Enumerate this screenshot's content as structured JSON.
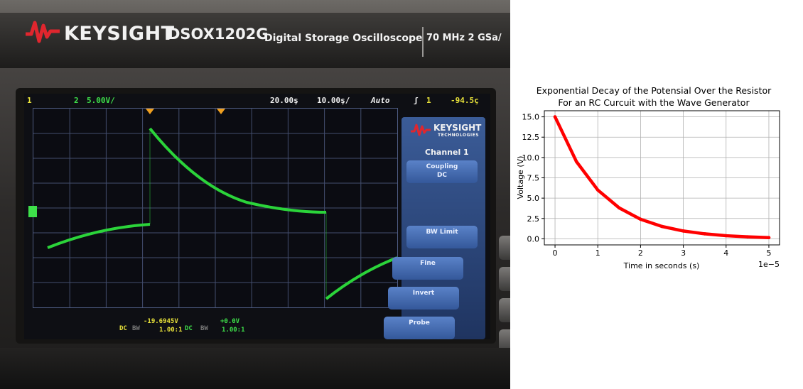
{
  "scope": {
    "brand": "KEYSIGHT",
    "model": "DSOX1202G",
    "subtitle": "Digital Storage Oscilloscope",
    "spec": "70 MHz 2 GSa/",
    "colors": {
      "trace": "#2bd43a",
      "ch1": "#e8e23a",
      "ch2": "#3ee04a",
      "panel": "#2c4a86"
    },
    "status": {
      "ch1_marker": "1",
      "ch2_marker": "2",
      "ch2_scale": "5.00V/",
      "delay": "20.00ş",
      "timebase": "10.00ş/",
      "mode": "Auto",
      "trigger_icon": "ʃ",
      "trigger_source": "1",
      "trigger_level": "-94.5ç"
    },
    "side_panel": {
      "logo": "KEYSIGHT",
      "logo_sub": "TECHNOLOGIES",
      "title": "Channel 1",
      "coupling_label": "Coupling",
      "coupling_value": "DC",
      "bw_limit": "BW Limit",
      "fine": "Fine",
      "invert": "Invert",
      "probe": "Probe"
    },
    "footer": {
      "ch1_coupling": "DC",
      "ch1_bw": "BW",
      "ch1_offset": "-19.6945V",
      "ch1_ratio": "1.00:1",
      "ch2_coupling": "DC",
      "ch2_bw": "BW",
      "ch2_offset": "+0.0V",
      "ch2_ratio": "1.00:1"
    }
  },
  "chart_data": {
    "type": "line",
    "title_line1": "Exponential Decay of the Potensial Over the Resistor",
    "title_line2": "For an RC Curcuit with the Wave Generator",
    "xlabel": "Time in seconds (s)",
    "ylabel": "Voltage (V)",
    "x_offset_text": "1e−5",
    "xlim": [
      -2.5e-06,
      5.25e-05
    ],
    "ylim": [
      -0.75,
      15.75
    ],
    "xticks": [
      0,
      1e-05,
      2e-05,
      3e-05,
      4e-05,
      5e-05
    ],
    "xtick_labels": [
      "0",
      "1",
      "2",
      "3",
      "4",
      "5"
    ],
    "yticks": [
      0,
      2.5,
      5,
      7.5,
      10,
      12.5,
      15
    ],
    "ytick_labels": [
      "0.0",
      "2.5",
      "5.0",
      "7.5",
      "10.0",
      "12.5",
      "15.0"
    ],
    "grid": true,
    "line_color": "#ff0000",
    "x": [
      0,
      5e-06,
      1e-05,
      1.5e-05,
      2e-05,
      2.5e-05,
      3e-05,
      3.5e-05,
      4e-05,
      4.5e-05,
      5e-05
    ],
    "series": [
      {
        "values": [
          15.0,
          9.5,
          6.0,
          3.8,
          2.4,
          1.52,
          0.96,
          0.61,
          0.38,
          0.24,
          0.15
        ]
      }
    ]
  }
}
